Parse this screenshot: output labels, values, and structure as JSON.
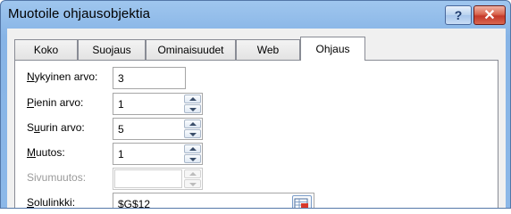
{
  "window": {
    "title": "Muotoile ohjausobjektia",
    "help_label": "?",
    "close_label": "✕"
  },
  "tabs": [
    {
      "label": "Koko",
      "active": false
    },
    {
      "label": "Suojaus",
      "active": false
    },
    {
      "label": "Ominaisuudet",
      "active": false
    },
    {
      "label": "Web",
      "active": false
    },
    {
      "label": "Ohjaus",
      "active": true
    }
  ],
  "fields": {
    "current_value": {
      "label_mnemonic": "N",
      "label_rest": "ykyinen arvo:",
      "value": "3"
    },
    "minimum": {
      "label_mnemonic": "P",
      "label_rest": "ienin arvo:",
      "value": "1"
    },
    "maximum": {
      "label_pre": "S",
      "label_mnemonic": "u",
      "label_rest": "urin arvo:",
      "value": "5"
    },
    "increment": {
      "label_mnemonic": "M",
      "label_rest": "uutos:",
      "value": "1"
    },
    "page_change": {
      "label": "Sivumuutos:",
      "value": "",
      "disabled": true
    },
    "cell_link": {
      "label_mnemonic": "S",
      "label_rest": "olulinkki:",
      "value": "$G$12"
    }
  },
  "icons": {
    "help": "question-mark",
    "close": "close-x",
    "spin_up": "triangle-up",
    "spin_down": "triangle-down",
    "cell_reference": "range-picker"
  }
}
